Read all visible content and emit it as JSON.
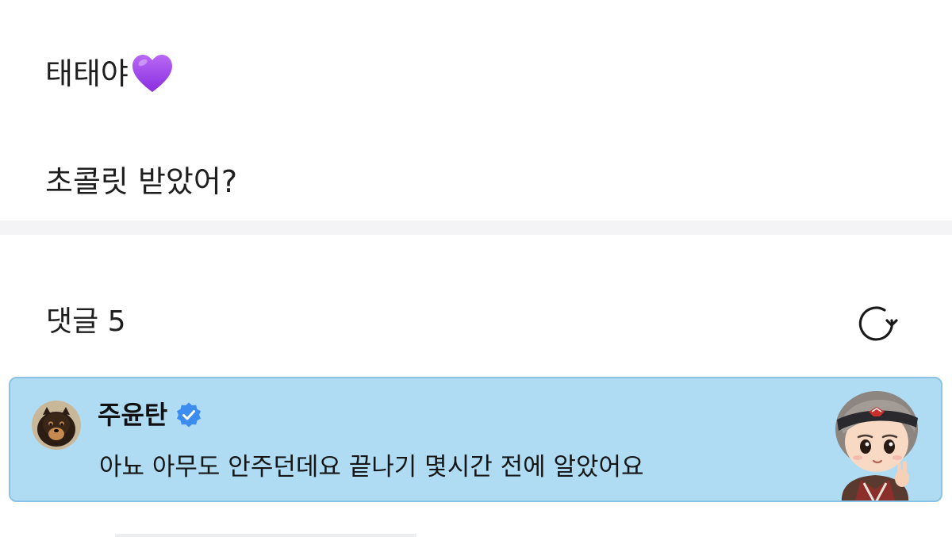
{
  "post": {
    "line1": "태태야",
    "line1_icon": "purple-heart-emoji",
    "line2": "초콜릿 받았어?"
  },
  "comments": {
    "header": "댓글 5",
    "refresh_icon": "refresh-icon"
  },
  "comment": {
    "author": "주윤탄",
    "verified_icon": "verified-badge-icon",
    "text": "아뇨 아무도 안주던데요 끝나기 몇시간 전에 알았어요",
    "avatar_icon": "dog-avatar",
    "sticker_icon": "character-sticker"
  },
  "colors": {
    "card_background": "#afdbf3",
    "card_border": "#8ac3e3",
    "verified": "#3d8cf0",
    "heart": "#9b3fe6"
  }
}
